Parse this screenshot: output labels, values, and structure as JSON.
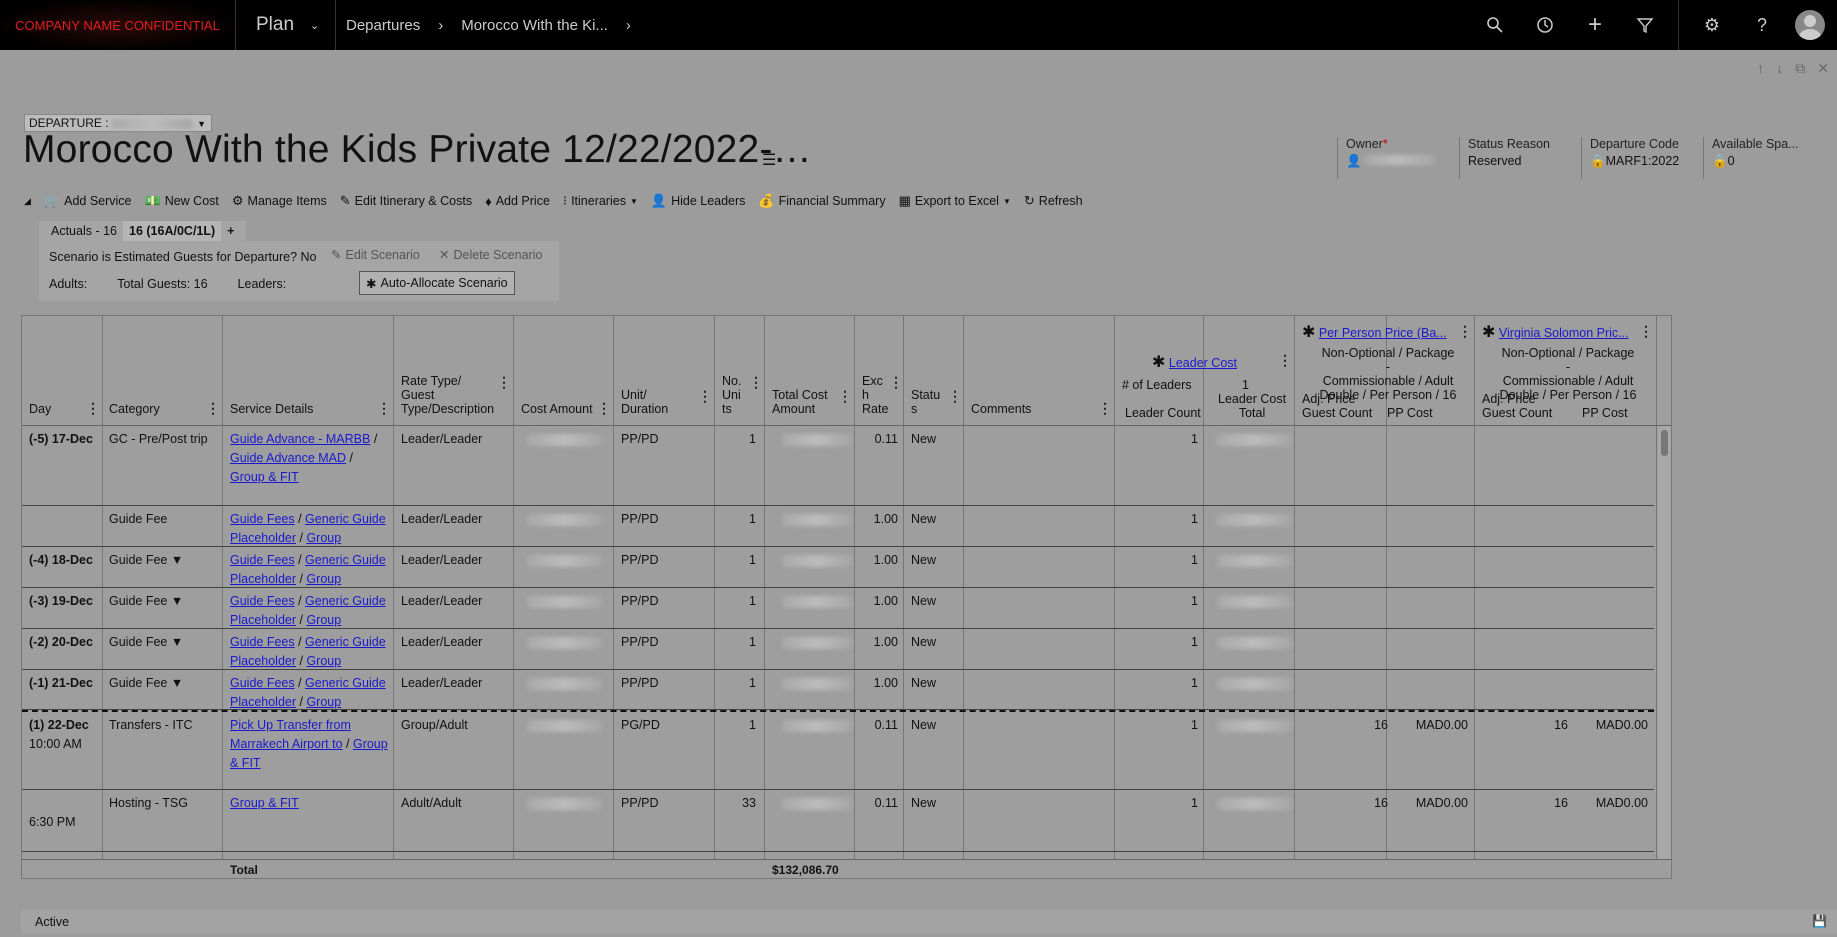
{
  "topbar": {
    "brand": "COMPANY NAME CONFIDENTIAL",
    "app": "Plan",
    "breadcrumb": [
      "Departures",
      "Morocco With the Ki..."
    ]
  },
  "form": {
    "selector_label": "DEPARTURE :",
    "title": "Morocco With the Kids Private 12/22/2022-…",
    "fields": [
      {
        "label": "Owner",
        "value": ""
      },
      {
        "label": "Status Reason",
        "value": "Reserved"
      },
      {
        "label": "Departure Code",
        "value": "MARF1:2022"
      },
      {
        "label": "Available Spa...",
        "value": "0"
      }
    ]
  },
  "commands": [
    {
      "icon": "cart-icon",
      "label": "Add Service"
    },
    {
      "icon": "cost-icon",
      "label": "New Cost"
    },
    {
      "icon": "gear-icon",
      "label": "Manage Items"
    },
    {
      "icon": "edit-icon",
      "label": "Edit Itinerary & Costs"
    },
    {
      "icon": "tag-icon",
      "label": "Add Price"
    },
    {
      "icon": "itinerary-icon",
      "label": "Itineraries"
    },
    {
      "icon": "person-icon",
      "label": "Hide Leaders"
    },
    {
      "icon": "money-icon",
      "label": "Financial Summary"
    },
    {
      "icon": "excel-icon",
      "label": "Export to Excel"
    },
    {
      "icon": "refresh-icon",
      "label": "Refresh"
    }
  ],
  "scenario": {
    "tabs": [
      "Actuals - 16",
      "16 (16A/0C/1L)",
      "+"
    ],
    "estimated": "Scenario is Estimated Guests for Departure? No",
    "edit": "Edit Scenario",
    "delete": "Delete Scenario",
    "adults": "Adults:",
    "total_guests": "Total Guests: 16",
    "leaders": "Leaders:",
    "auto": "Auto-Allocate Scenario"
  },
  "grid": {
    "headers": {
      "day": "Day",
      "category": "Category",
      "service": "Service Details",
      "rate_type": [
        "Rate Type/",
        "Guest",
        "Type/Description"
      ],
      "cost_amount": "Cost Amount",
      "unit": [
        "Unit/",
        "Duration"
      ],
      "units": [
        "No.",
        "Uni",
        "ts"
      ],
      "total_cost": [
        "Total Cost",
        "Amount"
      ],
      "exch": [
        "Exc",
        "h",
        "Rate"
      ],
      "status": [
        "Statu",
        "s"
      ],
      "comments": "Comments",
      "leader_cost": "Leader Cost",
      "leader_sub": [
        "# of Leaders",
        "1",
        "Leader Count",
        "Leader Cost",
        "Total"
      ],
      "pp_price": "Per Person Price (Ba...",
      "pp_desc": [
        "Non-Optional / Package -",
        "Commissionable / Adult",
        "Double / Per Person / 16"
      ],
      "vs_price": "Virginia Solomon Pric...",
      "vs_desc": [
        "Non-Optional / Package -",
        "Commissionable / Adult",
        "Double / Per Person / 16"
      ],
      "adj_price": [
        "Adj. Price",
        "Guest Count"
      ],
      "pp_cost": "PP Cost"
    },
    "rows": [
      {
        "day": "(-5) 17-Dec",
        "category": "GC - Pre/Post trip",
        "service": [
          "Guide Advance - MARBB",
          "Guide Advance MAD",
          "Group & FIT"
        ],
        "rate": "Leader/Leader",
        "unit": "PP/PD",
        "units": "1",
        "exch": "0.11",
        "status": "New",
        "leaders": "1",
        "adj1": "",
        "pp1": "",
        "adj2": "",
        "pp2": ""
      },
      {
        "day": "",
        "category": "Guide Fee",
        "service": [
          "Guide Fees",
          "Generic Guide Placeholder",
          "Group"
        ],
        "rate": "Leader/Leader",
        "unit": "PP/PD",
        "units": "1",
        "exch": "1.00",
        "status": "New",
        "leaders": "1",
        "adj1": "",
        "pp1": "",
        "adj2": "",
        "pp2": ""
      },
      {
        "day": "(-4) 18-Dec",
        "category": "Guide Fee ▼",
        "service": [
          "Guide Fees",
          "Generic Guide Placeholder",
          "Group"
        ],
        "rate": "Leader/Leader",
        "unit": "PP/PD",
        "units": "1",
        "exch": "1.00",
        "status": "New",
        "leaders": "1",
        "adj1": "",
        "pp1": "",
        "adj2": "",
        "pp2": ""
      },
      {
        "day": "(-3) 19-Dec",
        "category": "Guide Fee ▼",
        "service": [
          "Guide Fees",
          "Generic Guide Placeholder",
          "Group"
        ],
        "rate": "Leader/Leader",
        "unit": "PP/PD",
        "units": "1",
        "exch": "1.00",
        "status": "New",
        "leaders": "1",
        "adj1": "",
        "pp1": "",
        "adj2": "",
        "pp2": ""
      },
      {
        "day": "(-2) 20-Dec",
        "category": "Guide Fee ▼",
        "service": [
          "Guide Fees",
          "Generic Guide Placeholder",
          "Group"
        ],
        "rate": "Leader/Leader",
        "unit": "PP/PD",
        "units": "1",
        "exch": "1.00",
        "status": "New",
        "leaders": "1",
        "adj1": "",
        "pp1": "",
        "adj2": "",
        "pp2": ""
      },
      {
        "day": "(-1) 21-Dec",
        "category": "Guide Fee ▼",
        "service": [
          "Guide Fees",
          "Generic Guide Placeholder",
          "Group"
        ],
        "rate": "Leader/Leader",
        "unit": "PP/PD",
        "units": "1",
        "exch": "1.00",
        "status": "New",
        "leaders": "1",
        "adj1": "",
        "pp1": "",
        "adj2": "",
        "pp2": ""
      },
      {
        "day": "(1) 22-Dec",
        "time": "10:00 AM",
        "category": "Transfers - ITC",
        "service": [
          "Pick Up Transfer from Marrakech Airport to",
          "Group & FIT"
        ],
        "rate": "Group/Adult",
        "unit": "PG/PD",
        "units": "1",
        "exch": "0.11",
        "status": "New",
        "leaders": "1",
        "adj1": "16",
        "pp1": "MAD0.00",
        "adj2": "16",
        "pp2": "MAD0.00"
      },
      {
        "day": "",
        "time": "6:30 PM",
        "category": "Hosting - TSG",
        "service": [
          "Group & FIT"
        ],
        "rate": "Adult/Adult",
        "unit": "PP/PD",
        "units": "33",
        "exch": "0.11",
        "status": "New",
        "leaders": "1",
        "adj1": "16",
        "pp1": "MAD0.00",
        "adj2": "16",
        "pp2": "MAD0.00"
      }
    ],
    "total_label": "Total",
    "total_value": "$132,086.70"
  },
  "status_bar": "Active"
}
